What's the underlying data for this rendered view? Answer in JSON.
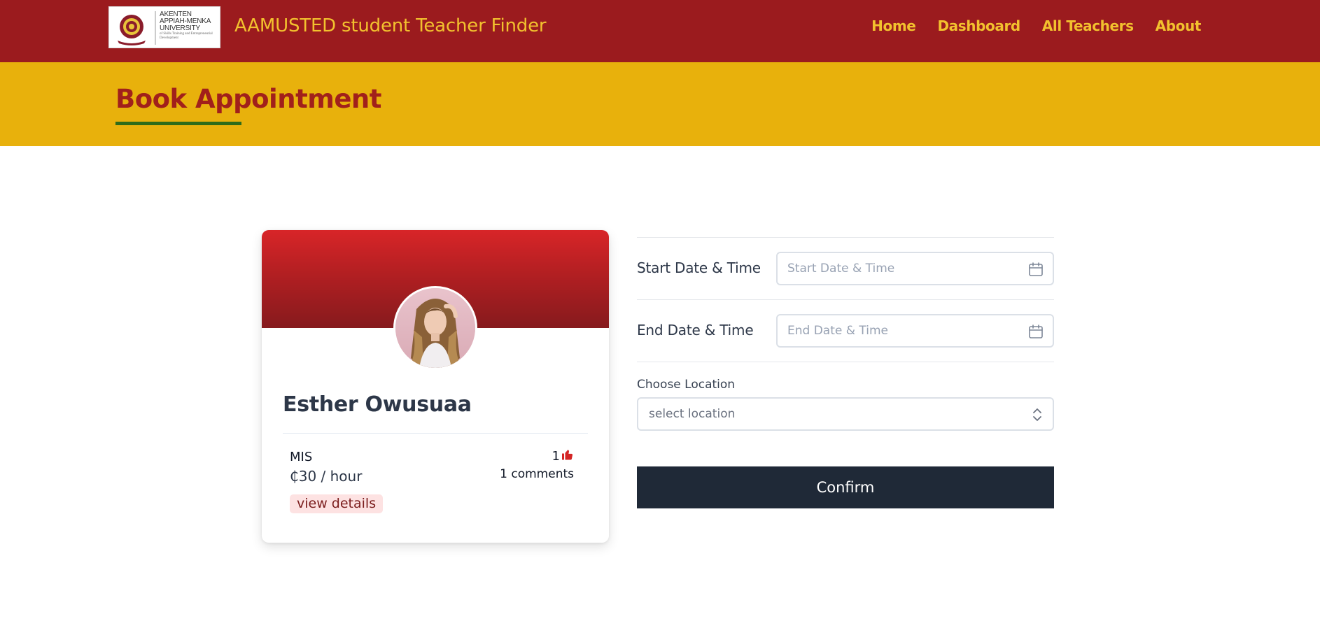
{
  "navbar": {
    "logo": {
      "line1": "AKENTEN",
      "line2": "APPIAH-MENKA",
      "line3": "UNIVERSITY",
      "tagline": "of Skills Training and Entrepreneurial Development"
    },
    "brand": "AAMUSTED student Teacher Finder",
    "links": [
      "Home",
      "Dashboard",
      "All Teachers",
      "About"
    ],
    "bg_color": "#9b1b1e",
    "accent_color": "#f2c12e"
  },
  "banner": {
    "title": "Book Appointment",
    "bg_color": "#e8b10c",
    "underline_color": "#2e6b1a"
  },
  "teacher_card": {
    "name": "Esther Owusuaa",
    "subject": "MIS",
    "rate": "₵30 / hour",
    "likes": "1",
    "like_icon": "thumbs-up-icon",
    "comments": "1 comments",
    "details_label": "view details"
  },
  "form": {
    "start_label": "Start Date & Time",
    "start_placeholder": "Start Date & Time",
    "end_label": "End Date & Time",
    "end_placeholder": "End Date & Time",
    "location_label": "Choose Location",
    "location_placeholder": "select location",
    "confirm_label": "Confirm",
    "calendar_icon": "calendar-icon",
    "select_icon": "chevron-up-down-icon"
  }
}
